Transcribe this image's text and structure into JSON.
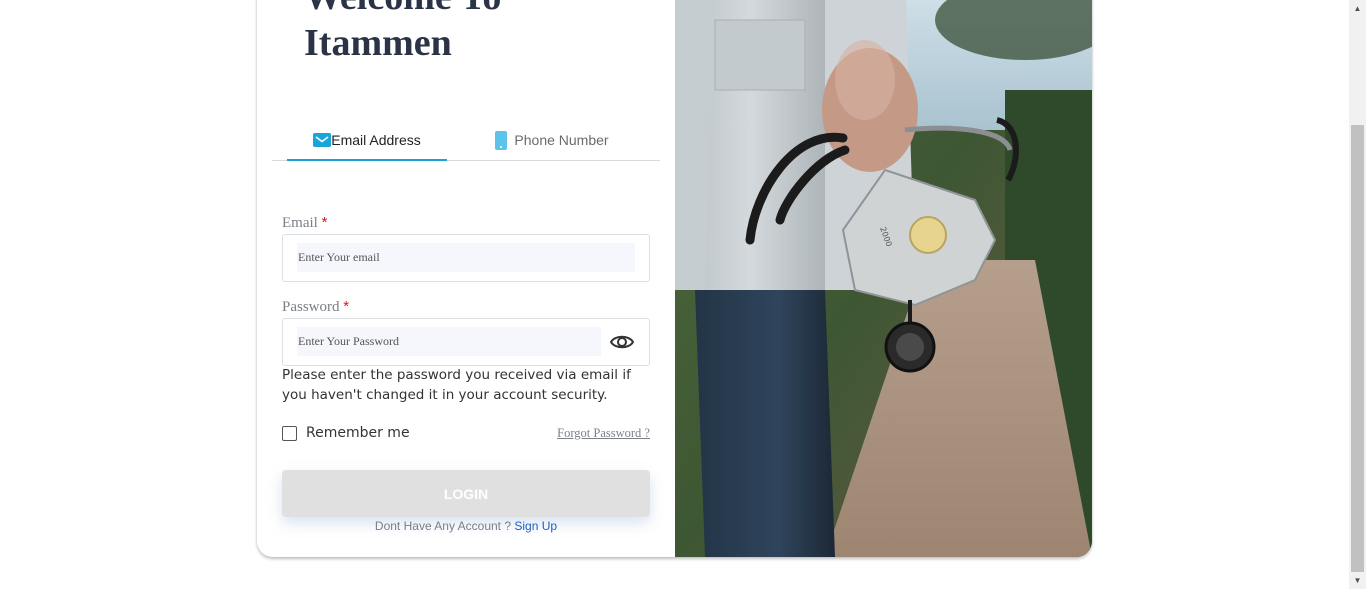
{
  "heading": {
    "line1": "Welcome To",
    "line2": "Itammen"
  },
  "tabs": [
    {
      "label": "Email Address",
      "icon": "mail-icon",
      "active": true
    },
    {
      "label": "Phone Number",
      "icon": "phone-icon",
      "active": false
    }
  ],
  "form": {
    "email": {
      "label": "Email",
      "required_mark": "*",
      "placeholder": "Enter Your email",
      "value": ""
    },
    "password": {
      "label": "Password",
      "required_mark": "*",
      "placeholder": "Enter Your Password",
      "value": "",
      "toggle_icon": "eye-icon"
    },
    "hint": "Please enter the password you received via email if you haven't changed it in your account security.",
    "remember_label": "Remember me",
    "forgot_label": "Forgot Password ?",
    "login_label": "LOGIN",
    "signup_prompt": "Dont Have Any Account ?",
    "signup_link": "Sign Up"
  },
  "colors": {
    "accent": "#1fa3d6",
    "heading": "#2a3446",
    "required": "#d11a1a",
    "link": "#1f5fbf",
    "button_disabled": "#e0e0e0"
  },
  "side_image": {
    "subject": "doctor holding stethoscope and face mask"
  }
}
